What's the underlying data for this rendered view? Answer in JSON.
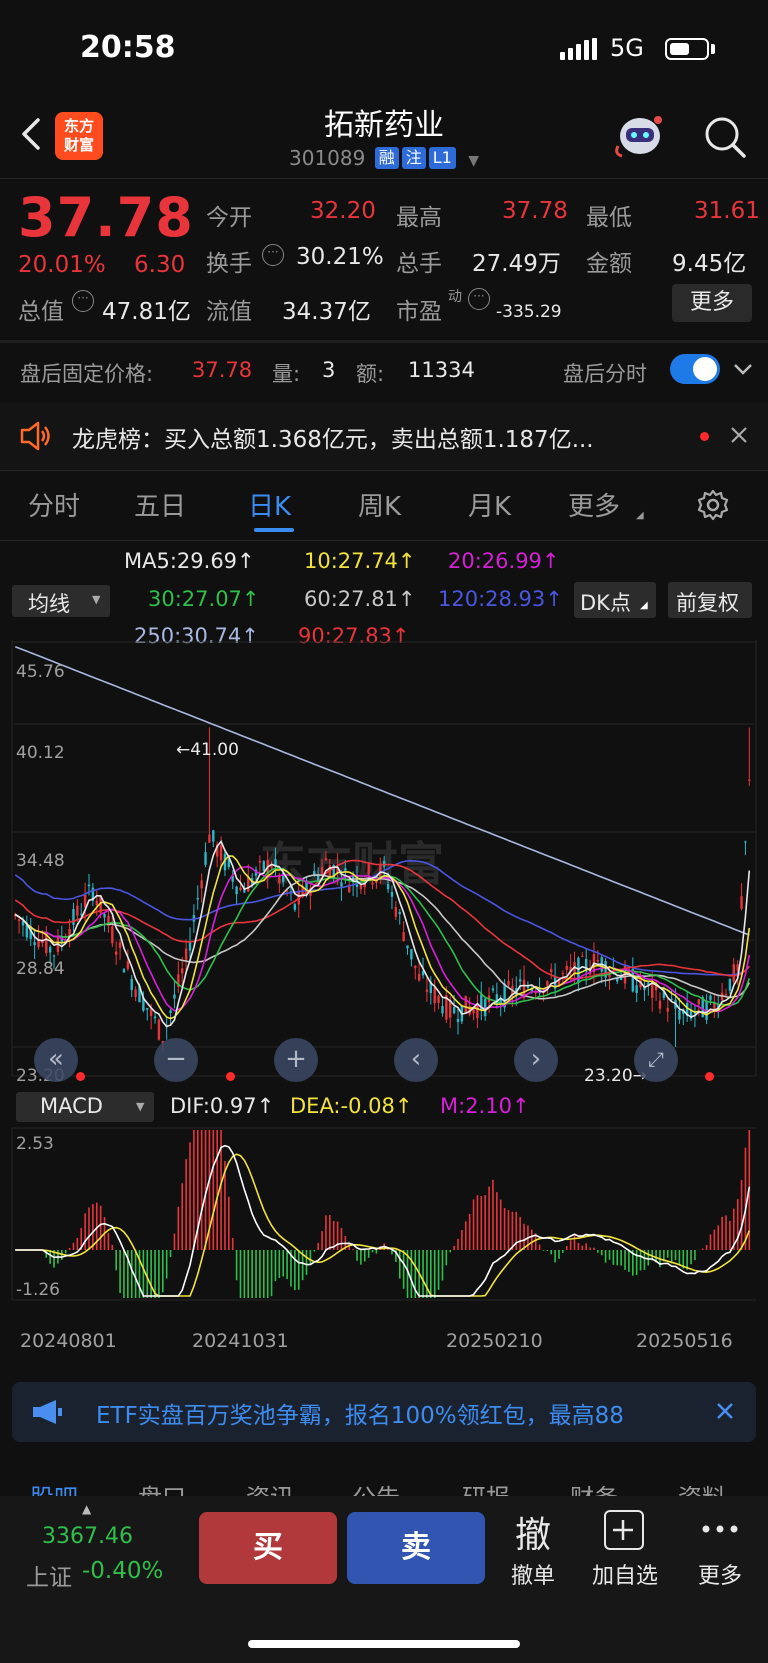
{
  "status": {
    "time": "20:58",
    "network": "5G",
    "battery_level": 0.55
  },
  "header": {
    "logo_line1": "东方",
    "logo_line2": "财富",
    "title": "拓新药业",
    "code": "301089",
    "tags": [
      "融",
      "注",
      "L1"
    ]
  },
  "quote": {
    "price": "37.78",
    "change_pct": "20.01%",
    "change_amt": "6.30",
    "open_label": "今开",
    "open": "32.20",
    "high_label": "最高",
    "high": "37.78",
    "low_label": "最低",
    "low": "31.61",
    "turnover_label": "换手",
    "turnover": "30.21%",
    "volume_label": "总手",
    "volume": "27.49万",
    "amount_label": "金额",
    "amount": "9.45亿",
    "mktcap_label": "总值",
    "mktcap": "47.81亿",
    "float_label": "流值",
    "float": "34.37亿",
    "pe_label": "市盈",
    "pe_sup": "动",
    "pe": "-335.29",
    "more": "更多"
  },
  "after_hours": {
    "price_label": "盘后固定价格:",
    "price": "37.78",
    "qty_label": "量:",
    "qty": "3",
    "amt_label": "额:",
    "amt": "11334",
    "toggle_label": "盘后分时",
    "toggle_on": true
  },
  "dragon_tiger": {
    "text": "龙虎榜：买入总额1.368亿元，卖出总额1.187亿..."
  },
  "tabs": [
    "分时",
    "五日",
    "日K",
    "周K",
    "月K",
    "更多"
  ],
  "active_tab": "日K",
  "ma_legend": {
    "selector": "均线",
    "ma5": "MA5:29.69↑",
    "ma10": "10:27.74↑",
    "ma20": "20:26.99↑",
    "ma30": "30:27.07↑",
    "ma60": "60:27.81↑",
    "ma120": "120:28.93↑",
    "ma250": "250:30.74↑",
    "ma90": "90:27.83↑",
    "dk_button": "DK点",
    "adjust_button": "前复权",
    "colors": {
      "ma5": "#e8e8e8",
      "ma10": "#f2e33c",
      "ma20": "#d61fd6",
      "ma30": "#2fbf4a",
      "ma60": "#c8c8c8",
      "ma120": "#4a55e0",
      "ma250": "#a8b8e0",
      "ma90": "#e8353b"
    }
  },
  "kchart": {
    "y_labels": [
      "45.76",
      "40.12",
      "34.48",
      "28.84",
      "23.20"
    ],
    "high_mark": "←41.00",
    "low_mark": "23.20→",
    "watermark": "东方财富",
    "nav_buttons": [
      "«",
      "−",
      "+",
      "‹",
      "›"
    ]
  },
  "macd": {
    "selector": "MACD",
    "dif": "DIF:0.97↑",
    "dea": "DEA:-0.08↑",
    "m": "M:2.10↑",
    "y_top": "2.53",
    "y_bottom": "-1.26",
    "dates": [
      "20240801",
      "20241031",
      "20250210",
      "20250516"
    ]
  },
  "banner": {
    "text": "ETF实盘百万奖池争霸，报名100%领红包，最高88"
  },
  "bottom_tabs": [
    "股吧",
    "盘口",
    "资讯",
    "公告",
    "研报",
    "财务",
    "资料"
  ],
  "index": {
    "value": "3367.46",
    "name": "上证",
    "change": "-0.40%"
  },
  "actions": {
    "buy": "买",
    "sell": "卖",
    "cancel_icon": "撤",
    "cancel": "撤单",
    "watch": "加自选",
    "more": "更多"
  }
}
